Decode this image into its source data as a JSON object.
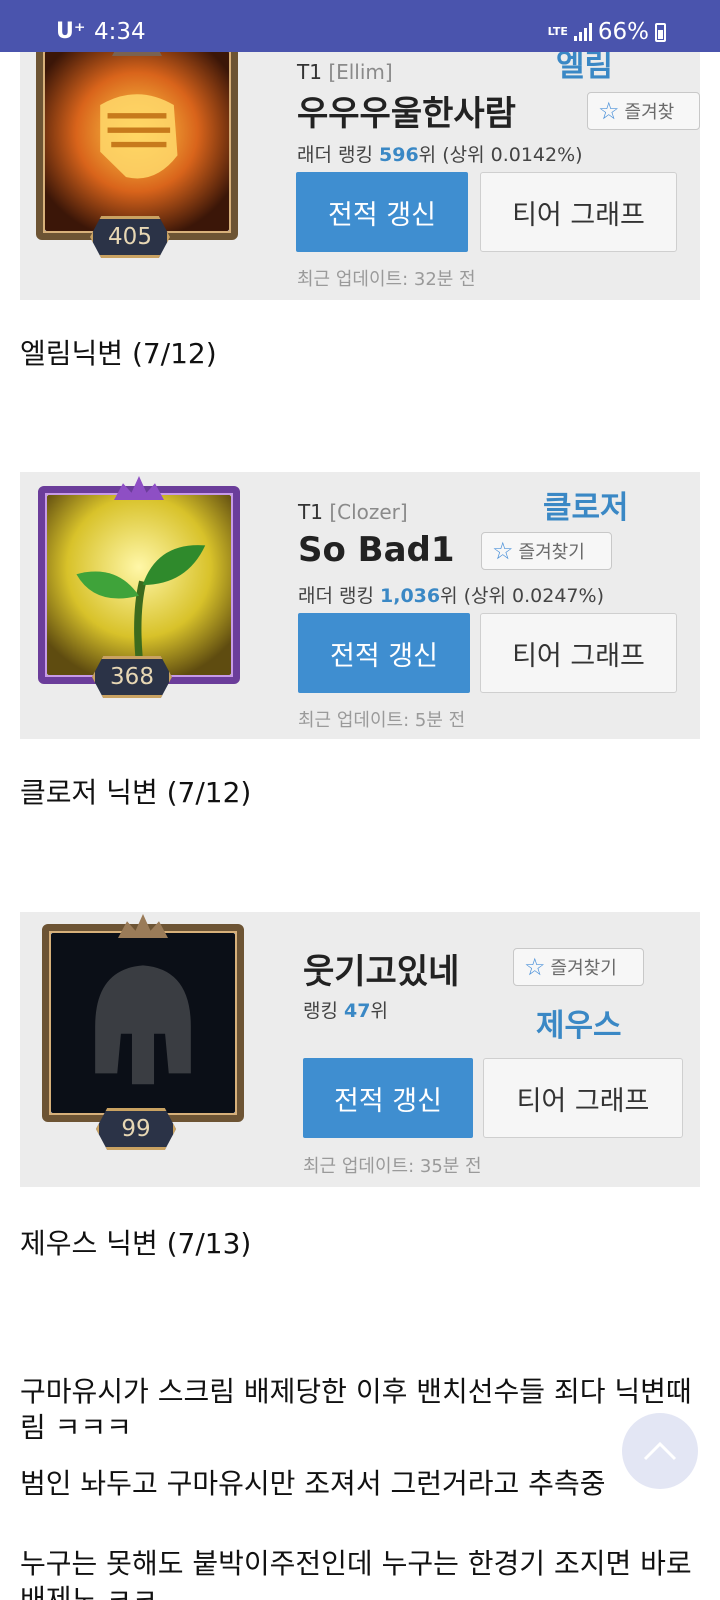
{
  "status_bar": {
    "carrier": "U⁺",
    "time": "4:34",
    "network": "LTE",
    "battery": "66%"
  },
  "cards": [
    {
      "team": "T1",
      "player_tag": "[Ellim]",
      "nickname": "우우우울한사람",
      "handle": "엘림",
      "favorite_label": "즐겨찾",
      "rank_prefix": "래더 랭킹 ",
      "rank_value": "596",
      "rank_suffix": "위 (상위 0.0142%)",
      "refresh_label": "전적 갱신",
      "graph_label": "티어 그래프",
      "updated": "최근 업데이트: 32분 전",
      "level": "405"
    },
    {
      "team": "T1",
      "player_tag": "[Clozer]",
      "nickname": "So Bad1",
      "handle": "클로저",
      "favorite_label": "즐겨찾기",
      "rank_prefix": "래더 랭킹 ",
      "rank_value": "1,036",
      "rank_suffix": "위 (상위 0.0247%)",
      "refresh_label": "전적 갱신",
      "graph_label": "티어 그래프",
      "updated": "최근 업데이트: 5분 전",
      "level": "368"
    },
    {
      "team": "",
      "player_tag": "",
      "nickname": "웃기고있네",
      "handle": "제우스",
      "favorite_label": "즐겨찾기",
      "rank_prefix": "랭킹 ",
      "rank_value": "47",
      "rank_suffix": "위",
      "refresh_label": "전적 갱신",
      "graph_label": "티어 그래프",
      "updated": "최근 업데이트: 35분 전",
      "level": "99"
    }
  ],
  "captions": [
    "엘림닉변 (7/12)",
    "클로저 닉변 (7/12)",
    "제우스 닉변 (7/13)"
  ],
  "paragraphs": [
    "구마유시가 스크림 배제당한 이후 밴치선수들 죄다 닉변때림 ㅋㅋㅋ",
    "범인 놔두고 구마유시만 조져서 그런거라고 추측중",
    "누구는 못해도 붙박이주전인데 누구는 한경기 조지면 바로 배제노 ㅋㅋ"
  ],
  "colors": {
    "status_bar": "#4a54ad",
    "accent_blue": "#3f8ed0",
    "handle_blue": "#3a88c5",
    "card_bg": "#ececec"
  },
  "icons": {
    "favorite": "star-outline-icon",
    "scroll_top": "chevron-up-icon"
  }
}
